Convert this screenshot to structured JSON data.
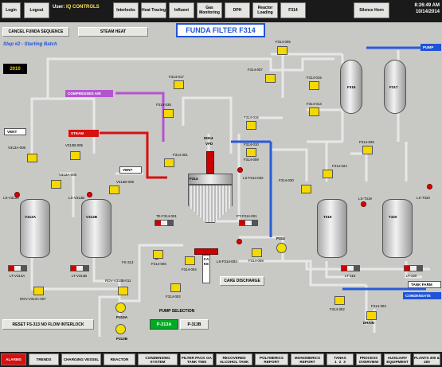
{
  "colors": {
    "accent_blue": "#1f54d6",
    "alarm_red": "#e00000",
    "valve_yellow": "#f4d800",
    "compressed_air": "#b455d0",
    "steam": "#d81010",
    "pump_active": "#00aa22"
  },
  "header": {
    "login": "Login",
    "logout": "Logout",
    "user_prefix": "User:",
    "user_name": "IQ CONTROLS",
    "nav": [
      "Interlocks",
      "Heat Tracing",
      "Influent",
      "Gas Monitoring",
      "DPH",
      "Reactor Loading",
      "F314"
    ],
    "silence_horn": "Silence Horn",
    "time": "8:26:49 AM",
    "date": "10/14/2014"
  },
  "controls": {
    "cancel_sequence": "CANCEL FUNDA SEQUENCE",
    "steam_heat": "STEAM HEAT",
    "step": "Step #2 - Starting Batch",
    "counter": "2010",
    "reset_interlock": "RESET FS-313 NO FLOW INTERLOCK",
    "cake_discharge": "CAKE DISCHARGE",
    "pump_selection": "PUMP SELECTION",
    "pump_a": "P-313A",
    "pump_b": "P-313B"
  },
  "title": "FUNDA FILTER F314",
  "line_tags": {
    "compressed_air": "COMPRESSED AIR",
    "steam": "STEAM",
    "vent_left": "VENT",
    "vent_mid": "VENT",
    "pump": "PUMP",
    "tank_farm": "TANK FARM",
    "condensate": "CONDENSATE",
    "drain": "DRAIN",
    "cake": "CAKE"
  },
  "labels": {
    "f314_005": "F314-005",
    "f314_007": "F314-007",
    "f314_017": "F314-017",
    "f314_036": "F314-036",
    "f314_001": "F314-001",
    "f314_015": "F314-015",
    "f314_014": "F314-014",
    "f314_016": "F314-016",
    "f314_010": "F314-010",
    "f314_025": "F314-025",
    "f314_024": "F314-024",
    "f314_030": "F314-030",
    "f314_009": "F314-009",
    "f314_303": "F314-303",
    "f314_302": "F314-302",
    "f314_006": "F314-006",
    "f314_004": "F314-004",
    "f314_002": "F314-002",
    "f314_301": "F314-301",
    "f314_008": "F314-008",
    "v313a_008": "V313A-008",
    "v313a_005": "V313A-005",
    "v313b_005": "V313B-005",
    "v313b_008": "V313B-008",
    "v313a": "V313A",
    "v313b": "V313B",
    "ls_v313a": "LS-V313A",
    "ls_v313b": "LS-V313B",
    "lt_v313a": "LT-V313A",
    "lt_v313b": "LT-V313B",
    "rov_v313a": "ROV-V313A-007",
    "rov_v313b": "ROV-V313B-011",
    "fs313": "FS-313",
    "p313a": "P313A",
    "p313b": "P313B",
    "m314": "M314",
    "vfd": "VFD",
    "f314": "F314",
    "te": "TE-F314-001",
    "pt": "PT-F314-001",
    "ls_f314": "LS-F314-002",
    "ls_f314b": "LS-F314-001",
    "p314": "P314",
    "f316": "F316",
    "f317": "F317",
    "t319": "T319",
    "t320": "T320",
    "ls_t319": "LS-T319",
    "ls_t320": "LS-T320",
    "lt_t319": "LT-319",
    "lt_t320": "LT-320"
  },
  "bottom_nav": [
    "ALARMS",
    "TRENDS",
    "CHARGING VESSEL",
    "REACTOR",
    "CONDENSING SYSTEM",
    "FILTER PACK GA TANK T550",
    "RECOVERED ALCOHOL TANK",
    "POLYMERICS REPORT",
    "MONOMERICS REPORT",
    "TANKS",
    "PROCESS OVERVIEW",
    "AUXILIARY EQUIPMENT",
    "PLANTS 300 & 400"
  ],
  "tanks_sub": [
    "1",
    "2",
    "3"
  ]
}
